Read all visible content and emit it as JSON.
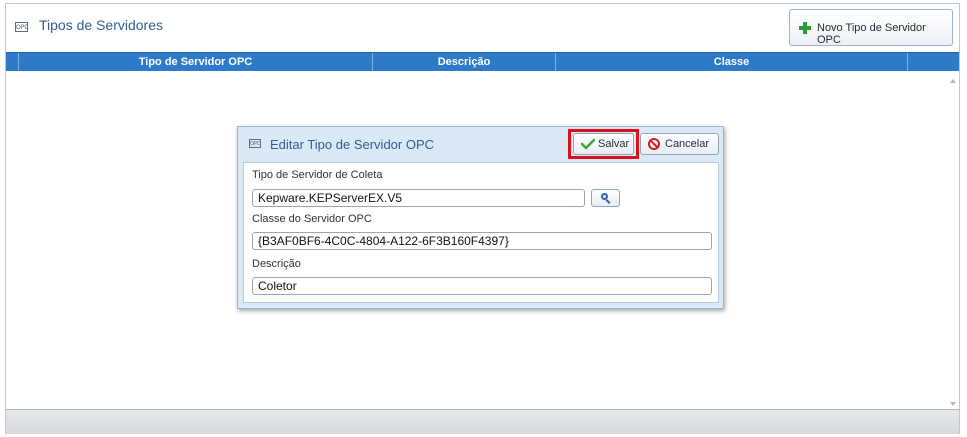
{
  "page": {
    "title": "Tipos de Servidores",
    "icon": "opc-icon",
    "new_button_label": "Novo Tipo de Servidor OPC"
  },
  "grid": {
    "columns": [
      "Tipo de Servidor OPC",
      "Descrição",
      "Classe"
    ]
  },
  "dialog": {
    "title": "Editar Tipo de Servidor OPC",
    "save_label": "Salvar",
    "cancel_label": "Cancelar",
    "fields": {
      "collector_type_label": "Tipo de Servidor de Coleta",
      "collector_type_value": "Kepware.KEPServerEX.V5",
      "opc_class_label": "Classe do Servidor OPC",
      "opc_class_value": "{B3AF0BF6-4C0C-4804-A122-6F3B160F4397}",
      "description_label": "Descrição",
      "description_value": "Coletor"
    }
  },
  "colors": {
    "header_blue": "#2d7ac9",
    "title_blue": "#2f5f93",
    "highlight_red": "#e0101a",
    "plus_green": "#2e9a35"
  }
}
